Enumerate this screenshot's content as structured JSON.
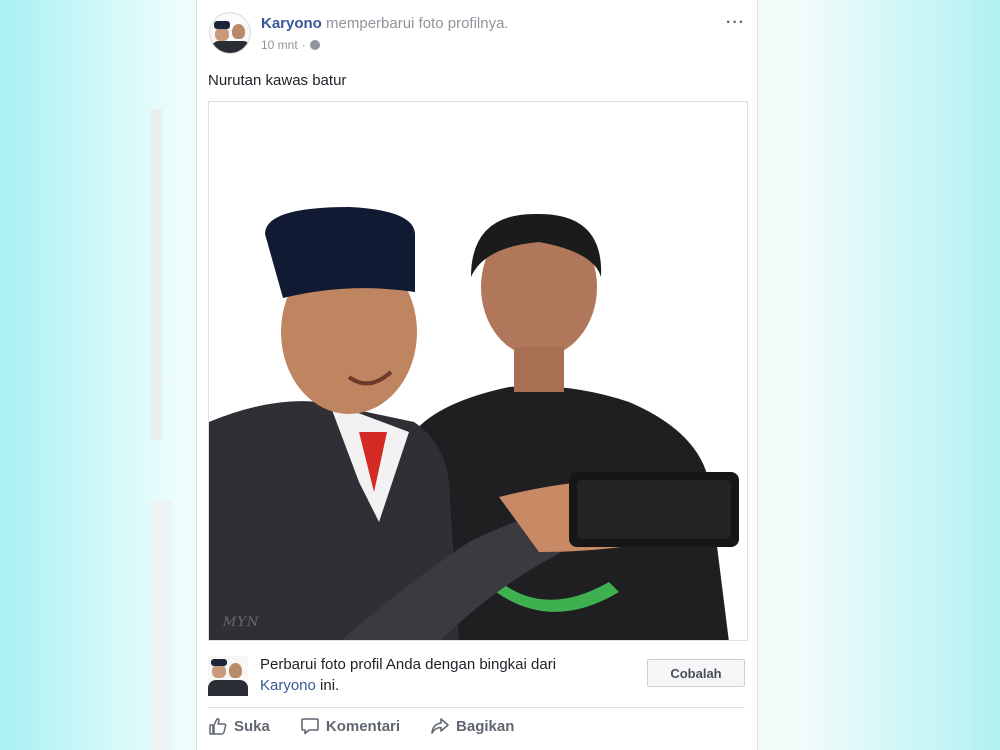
{
  "post": {
    "author": "Karyono",
    "action_text": "memperbarui foto profilnya.",
    "time": "10 mnt",
    "time_separator": "·",
    "more_label": "···",
    "caption": "Nurutan kawas batur",
    "photo": {
      "watermark": "MYN"
    }
  },
  "frame_promo": {
    "text_before": "Perbarui foto profil Anda dengan bingkai dari",
    "author": "Karyono",
    "text_after": "ini.",
    "button_label": "Cobalah"
  },
  "actions": {
    "like": "Suka",
    "comment": "Komentari",
    "share": "Bagikan"
  },
  "icons": [
    "globe-icon",
    "more-options-icon",
    "like-icon",
    "comment-icon",
    "share-icon"
  ],
  "colors": {
    "link": "#385898",
    "muted": "#90949c",
    "text": "#1d2129",
    "action": "#616770"
  }
}
